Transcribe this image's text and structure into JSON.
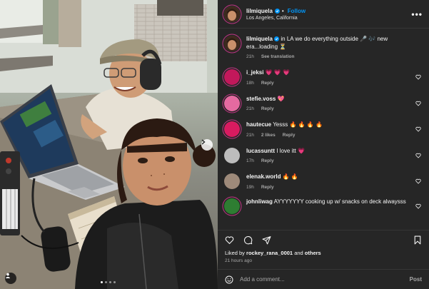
{
  "header": {
    "username": "lilmiquela",
    "follow_label": "Follow",
    "separator": "•",
    "location": "Los Angeles, California",
    "more_label": "•••"
  },
  "caption": {
    "username": "lilmiquela",
    "text": "in LA we do everything outside 🎤 🎶 new era...loading ⏳",
    "time": "21h",
    "see_translation": "See translation"
  },
  "comments": [
    {
      "username": "i_jeksi",
      "text": "💗 💗 💗",
      "time": "18h",
      "likes": "",
      "reply": "Reply",
      "avatar_color": "#c2185b"
    },
    {
      "username": "stefie.voss",
      "text": "💖",
      "time": "21h",
      "likes": "",
      "reply": "Reply",
      "avatar_color": "#e46aa0"
    },
    {
      "username": "hautecue",
      "text": "Yesss 🔥 🔥 🔥 🔥",
      "time": "21h",
      "likes": "2 likes",
      "reply": "Reply",
      "avatar_color": "#d81b60"
    },
    {
      "username": "lucassuntt",
      "text": "I love itt 💗",
      "time": "17h",
      "likes": "",
      "reply": "Reply",
      "avatar_color": "#bdbdbd"
    },
    {
      "username": "elenak.world",
      "text": "🔥 🔥",
      "time": "19h",
      "likes": "",
      "reply": "Reply",
      "avatar_color": "#9e8a7a"
    },
    {
      "username": "johnliwag",
      "text": "AYYYYYYY cooking up w/ snacks on deck alwaysss",
      "time": "",
      "likes": "",
      "reply": "",
      "avatar_color": "#2e7d32"
    }
  ],
  "actions": {
    "like_icon": "heart-icon",
    "comment_icon": "comment-icon",
    "share_icon": "share-icon",
    "save_icon": "bookmark-icon"
  },
  "likes": {
    "prefix": "Liked by",
    "user": "rockey_rana_0001",
    "connector": "and",
    "others": "others"
  },
  "time_ago": "21 hours ago",
  "add_comment": {
    "placeholder": "Add a comment...",
    "post_label": "Post"
  },
  "carousel": {
    "current": 1,
    "total": 4
  },
  "colors": {
    "accent": "#0095f6",
    "panel_bg": "#262626",
    "muted": "#a8a8a8"
  }
}
